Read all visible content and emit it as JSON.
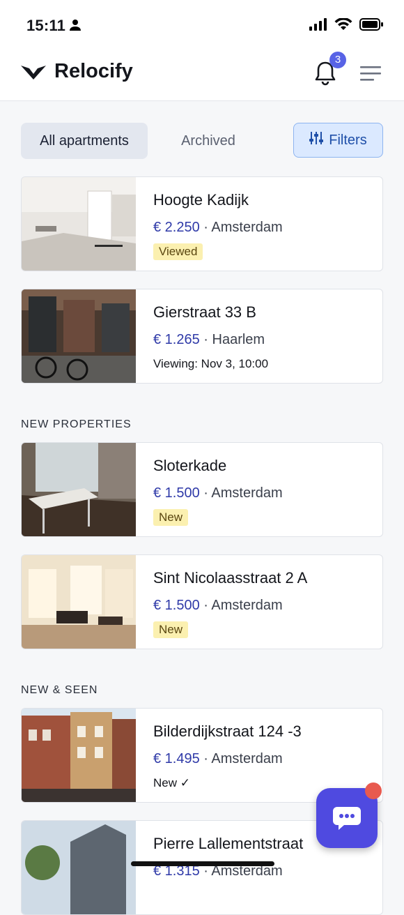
{
  "status": {
    "time": "15:11"
  },
  "header": {
    "app_name": "Relocify",
    "notification_count": "3"
  },
  "tabs": {
    "all": "All apartments",
    "archived": "Archived",
    "filters": "Filters"
  },
  "sections": {
    "new_properties": "NEW PROPERTIES",
    "new_seen": "NEW & SEEN"
  },
  "colors": {
    "brand": "#4f4ae0",
    "price": "#2f3aa8",
    "badge": "#5863e6",
    "pill": "#fbf0b0"
  },
  "listings": [
    {
      "title": "Hoogte Kadijk",
      "price": "€ 2.250",
      "city": "Amsterdam",
      "tag": "Viewed"
    },
    {
      "title": "Gierstraat 33 B",
      "price": "€ 1.265",
      "city": "Haarlem",
      "note": "Viewing: Nov 3, 10:00"
    },
    {
      "title": "Sloterkade",
      "price": "€ 1.500",
      "city": "Amsterdam",
      "tag": "New"
    },
    {
      "title": "Sint Nicolaasstraat 2 A",
      "price": "€ 1.500",
      "city": "Amsterdam",
      "tag": "New"
    },
    {
      "title": "Bilderdijkstraat 124 -3",
      "price": "€ 1.495",
      "city": "Amsterdam",
      "note": "New ✓"
    },
    {
      "title": "Pierre Lallementstraat",
      "price": "€ 1.315",
      "city": "Amsterdam"
    }
  ],
  "icons": [
    "person-icon",
    "signal-icon",
    "wifi-icon",
    "battery-icon",
    "logo-icon",
    "bell-icon",
    "menu-icon",
    "filters-icon",
    "chat-icon"
  ]
}
